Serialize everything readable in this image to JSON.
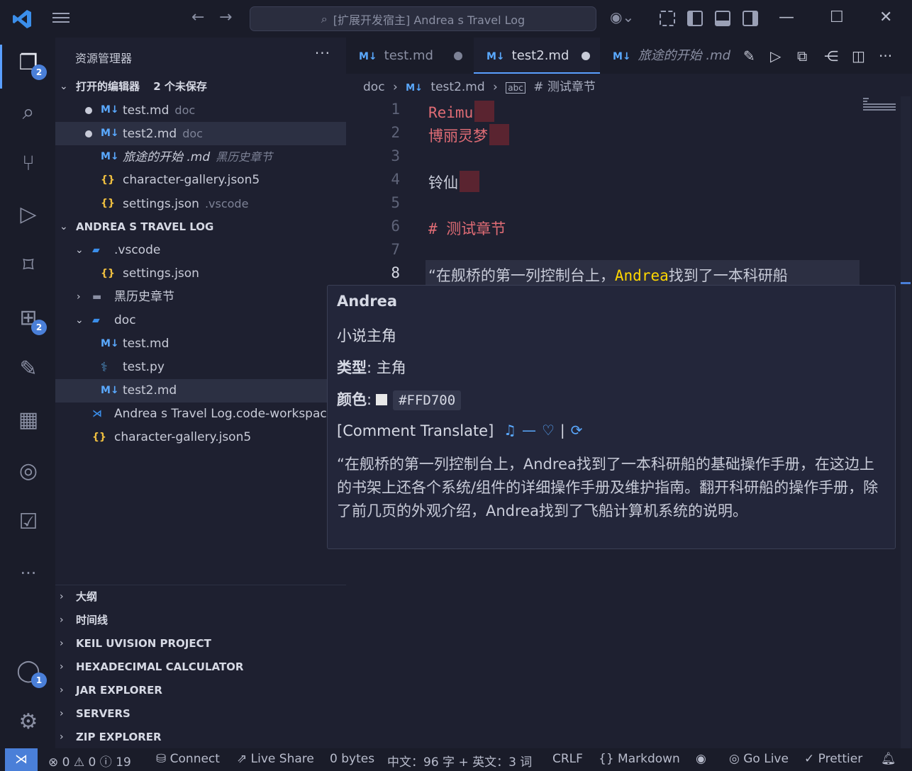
{
  "titlebar": {
    "search_text": "[扩展开发宿主] Andrea s Travel Log"
  },
  "activity": {
    "explorer_badge": "2",
    "extensions_badge": "2",
    "accounts_badge": "1"
  },
  "sidebar": {
    "title": "资源管理器",
    "open_editors": {
      "header": "打开的编辑器",
      "unsaved": "2 个未保存",
      "items": [
        {
          "name": "test.md",
          "desc": "doc"
        },
        {
          "name": "test2.md",
          "desc": "doc"
        },
        {
          "name": "旅途的开始 .md",
          "desc": "黑历史章节"
        },
        {
          "name": "character-gallery.json5",
          "desc": ""
        },
        {
          "name": "settings.json",
          "desc": ".vscode"
        }
      ]
    },
    "workspace": {
      "header": "ANDREA S TRAVEL LOG",
      "items": [
        {
          "name": ".vscode"
        },
        {
          "name": "settings.json"
        },
        {
          "name": "黑历史章节"
        },
        {
          "name": "doc"
        },
        {
          "name": "test.md"
        },
        {
          "name": "test.py"
        },
        {
          "name": "test2.md"
        },
        {
          "name": "Andrea s Travel Log.code-workspace"
        },
        {
          "name": "character-gallery.json5"
        }
      ]
    },
    "panels": [
      "大纲",
      "时间线",
      "KEIL UVISION PROJECT",
      "HEXADECIMAL CALCULATOR",
      "JAR EXPLORER",
      "SERVERS",
      "ZIP EXPLORER"
    ]
  },
  "tabs": [
    {
      "label": "test.md"
    },
    {
      "label": "test2.md"
    },
    {
      "label": "旅途的开始 .md"
    }
  ],
  "breadcrumb": {
    "folder": "doc",
    "file": "test2.md",
    "symbol": "# 测试章节"
  },
  "editor": {
    "lines": [
      {
        "n": "1",
        "text": "Reimu"
      },
      {
        "n": "2",
        "text": "博丽灵梦"
      },
      {
        "n": "3",
        "text": ""
      },
      {
        "n": "4",
        "text": "铃仙"
      },
      {
        "n": "5",
        "text": ""
      },
      {
        "n": "6",
        "text": "# 测试章节"
      },
      {
        "n": "7",
        "text": ""
      },
      {
        "n": "8",
        "pre": "“在舰桥的第一列控制台上，",
        "name": "Andrea",
        "post": "找到了一本科研船"
      }
    ]
  },
  "hover": {
    "title": "Andrea",
    "subtitle": "小说主角",
    "type_label": "类型",
    "type_value": ": 主角",
    "color_label": "颜色",
    "color_value": "#FFD700",
    "translate_label": "[Comment Translate]",
    "translation": "“在舰桥的第一列控制台上，Andrea找到了一本科研船的基础操作手册，在这边上的书架上还各个系统/组件的详细操作手册及维护指南。翻开科研船的操作手册，除了前几页的外观介绍，Andrea找到了飞船计算机系统的说明。"
  },
  "statusbar": {
    "errors": "0",
    "warnings": "0",
    "infos": "19",
    "connect": "Connect",
    "live_share": "Live Share",
    "bytes": "0 bytes",
    "wordcount": "中文：96 字 + 英文：3 词",
    "eol": "CRLF",
    "language": "Markdown",
    "go_live": "Go Live",
    "prettier": "Prettier"
  },
  "colors": {
    "accent": "#4a7fd8",
    "highlight_name": "#FFD700",
    "markdown_red": "#e06c75"
  }
}
